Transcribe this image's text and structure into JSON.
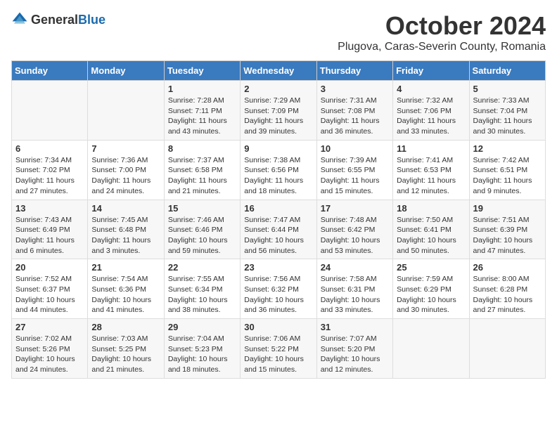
{
  "header": {
    "logo_general": "General",
    "logo_blue": "Blue",
    "month_title": "October 2024",
    "subtitle": "Plugova, Caras-Severin County, Romania"
  },
  "days_of_week": [
    "Sunday",
    "Monday",
    "Tuesday",
    "Wednesday",
    "Thursday",
    "Friday",
    "Saturday"
  ],
  "weeks": [
    [
      {
        "day": "",
        "info": ""
      },
      {
        "day": "",
        "info": ""
      },
      {
        "day": "1",
        "info": "Sunrise: 7:28 AM\nSunset: 7:11 PM\nDaylight: 11 hours and 43 minutes."
      },
      {
        "day": "2",
        "info": "Sunrise: 7:29 AM\nSunset: 7:09 PM\nDaylight: 11 hours and 39 minutes."
      },
      {
        "day": "3",
        "info": "Sunrise: 7:31 AM\nSunset: 7:08 PM\nDaylight: 11 hours and 36 minutes."
      },
      {
        "day": "4",
        "info": "Sunrise: 7:32 AM\nSunset: 7:06 PM\nDaylight: 11 hours and 33 minutes."
      },
      {
        "day": "5",
        "info": "Sunrise: 7:33 AM\nSunset: 7:04 PM\nDaylight: 11 hours and 30 minutes."
      }
    ],
    [
      {
        "day": "6",
        "info": "Sunrise: 7:34 AM\nSunset: 7:02 PM\nDaylight: 11 hours and 27 minutes."
      },
      {
        "day": "7",
        "info": "Sunrise: 7:36 AM\nSunset: 7:00 PM\nDaylight: 11 hours and 24 minutes."
      },
      {
        "day": "8",
        "info": "Sunrise: 7:37 AM\nSunset: 6:58 PM\nDaylight: 11 hours and 21 minutes."
      },
      {
        "day": "9",
        "info": "Sunrise: 7:38 AM\nSunset: 6:56 PM\nDaylight: 11 hours and 18 minutes."
      },
      {
        "day": "10",
        "info": "Sunrise: 7:39 AM\nSunset: 6:55 PM\nDaylight: 11 hours and 15 minutes."
      },
      {
        "day": "11",
        "info": "Sunrise: 7:41 AM\nSunset: 6:53 PM\nDaylight: 11 hours and 12 minutes."
      },
      {
        "day": "12",
        "info": "Sunrise: 7:42 AM\nSunset: 6:51 PM\nDaylight: 11 hours and 9 minutes."
      }
    ],
    [
      {
        "day": "13",
        "info": "Sunrise: 7:43 AM\nSunset: 6:49 PM\nDaylight: 11 hours and 6 minutes."
      },
      {
        "day": "14",
        "info": "Sunrise: 7:45 AM\nSunset: 6:48 PM\nDaylight: 11 hours and 3 minutes."
      },
      {
        "day": "15",
        "info": "Sunrise: 7:46 AM\nSunset: 6:46 PM\nDaylight: 10 hours and 59 minutes."
      },
      {
        "day": "16",
        "info": "Sunrise: 7:47 AM\nSunset: 6:44 PM\nDaylight: 10 hours and 56 minutes."
      },
      {
        "day": "17",
        "info": "Sunrise: 7:48 AM\nSunset: 6:42 PM\nDaylight: 10 hours and 53 minutes."
      },
      {
        "day": "18",
        "info": "Sunrise: 7:50 AM\nSunset: 6:41 PM\nDaylight: 10 hours and 50 minutes."
      },
      {
        "day": "19",
        "info": "Sunrise: 7:51 AM\nSunset: 6:39 PM\nDaylight: 10 hours and 47 minutes."
      }
    ],
    [
      {
        "day": "20",
        "info": "Sunrise: 7:52 AM\nSunset: 6:37 PM\nDaylight: 10 hours and 44 minutes."
      },
      {
        "day": "21",
        "info": "Sunrise: 7:54 AM\nSunset: 6:36 PM\nDaylight: 10 hours and 41 minutes."
      },
      {
        "day": "22",
        "info": "Sunrise: 7:55 AM\nSunset: 6:34 PM\nDaylight: 10 hours and 38 minutes."
      },
      {
        "day": "23",
        "info": "Sunrise: 7:56 AM\nSunset: 6:32 PM\nDaylight: 10 hours and 36 minutes."
      },
      {
        "day": "24",
        "info": "Sunrise: 7:58 AM\nSunset: 6:31 PM\nDaylight: 10 hours and 33 minutes."
      },
      {
        "day": "25",
        "info": "Sunrise: 7:59 AM\nSunset: 6:29 PM\nDaylight: 10 hours and 30 minutes."
      },
      {
        "day": "26",
        "info": "Sunrise: 8:00 AM\nSunset: 6:28 PM\nDaylight: 10 hours and 27 minutes."
      }
    ],
    [
      {
        "day": "27",
        "info": "Sunrise: 7:02 AM\nSunset: 5:26 PM\nDaylight: 10 hours and 24 minutes."
      },
      {
        "day": "28",
        "info": "Sunrise: 7:03 AM\nSunset: 5:25 PM\nDaylight: 10 hours and 21 minutes."
      },
      {
        "day": "29",
        "info": "Sunrise: 7:04 AM\nSunset: 5:23 PM\nDaylight: 10 hours and 18 minutes."
      },
      {
        "day": "30",
        "info": "Sunrise: 7:06 AM\nSunset: 5:22 PM\nDaylight: 10 hours and 15 minutes."
      },
      {
        "day": "31",
        "info": "Sunrise: 7:07 AM\nSunset: 5:20 PM\nDaylight: 10 hours and 12 minutes."
      },
      {
        "day": "",
        "info": ""
      },
      {
        "day": "",
        "info": ""
      }
    ]
  ]
}
